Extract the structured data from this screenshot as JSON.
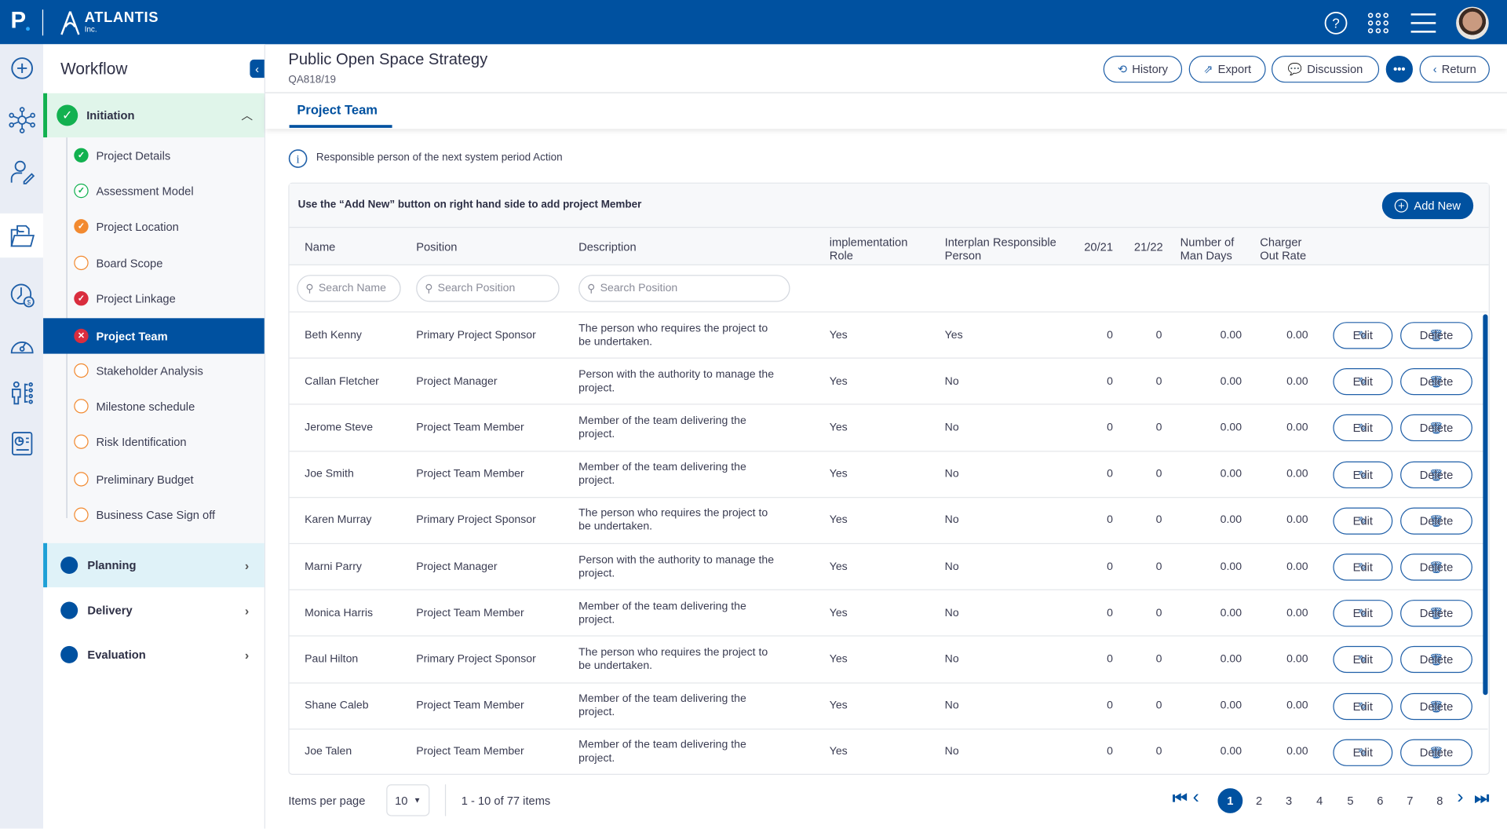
{
  "header": {
    "logo_letter": "P",
    "brand": "ATLANTIS",
    "brand_sub": "Inc.",
    "icons": [
      "help-icon",
      "apps-grid-icon",
      "menu-icon",
      "user-avatar"
    ]
  },
  "rail": {
    "icons": [
      "add-circle-icon",
      "network-icon",
      "user-edit-icon",
      "folder-icon",
      "time-money-icon",
      "speedometer-icon",
      "org-chart-icon",
      "report-icon"
    ]
  },
  "workflow": {
    "title": "Workflow",
    "initiation": {
      "label": "Initiation",
      "status": "complete"
    },
    "items": [
      {
        "label": "Project Details",
        "status": "complete",
        "color": "#12b150"
      },
      {
        "label": "Assessment Model",
        "status": "complete-outline",
        "color": "#12b150"
      },
      {
        "label": "Project Location",
        "status": "warning",
        "color": "#f28a30"
      },
      {
        "label": "Board Scope",
        "status": "pending",
        "color": "#f28a30"
      },
      {
        "label": "Project Linkage",
        "status": "error-complete",
        "color": "#d92d3e"
      },
      {
        "label": "Project Team",
        "status": "error",
        "color": "#d92d3e"
      },
      {
        "label": "Stakeholder Analysis",
        "status": "pending",
        "color": "#f28a30"
      },
      {
        "label": "Milestone schedule",
        "status": "pending",
        "color": "#f28a30"
      },
      {
        "label": "Risk Identification",
        "status": "pending",
        "color": "#f28a30"
      },
      {
        "label": "Preliminary Budget",
        "status": "pending",
        "color": "#f28a30"
      },
      {
        "label": "Business Case Sign off",
        "status": "pending",
        "color": "#f28a30"
      }
    ],
    "phases": [
      {
        "label": "Planning"
      },
      {
        "label": "Delivery"
      },
      {
        "label": "Evaluation"
      }
    ]
  },
  "page": {
    "title": "Public Open Space Strategy",
    "code": "QA818/19",
    "actions": {
      "history": "History",
      "export": "Export",
      "discussion": "Discussion",
      "return": "Return"
    },
    "tab": "Project Team",
    "info": "Responsible person of the next system period Action"
  },
  "table": {
    "instruction": "Use the “Add New” button on right hand side to add project Member",
    "add_new": "Add New",
    "columns": [
      "Name",
      "Position",
      "Description",
      "implementation Role",
      "Interplan Responsible Person",
      "20/21",
      "21/22",
      "Number of Man Days",
      "Charger Out Rate"
    ],
    "search": {
      "name": "Search Name",
      "position": "Search Position",
      "description": "Search Position"
    },
    "edit_label": "Edit",
    "delete_label": "Delete",
    "rows": [
      {
        "name": "Beth Kenny",
        "position": "Primary Project Sponsor",
        "description": "The person who requires the project to be undertaken.",
        "impl": "Yes",
        "interplan": "Yes",
        "y2021": "0",
        "y2122": "0",
        "man_days": "0.00",
        "rate": "0.00"
      },
      {
        "name": "Callan Fletcher",
        "position": "Project Manager",
        "description": "Person with the authority to manage the project.",
        "impl": "Yes",
        "interplan": "No",
        "y2021": "0",
        "y2122": "0",
        "man_days": "0.00",
        "rate": "0.00"
      },
      {
        "name": "Jerome Steve",
        "position": "Project Team Member",
        "description": "Member of the team delivering the project.",
        "impl": "Yes",
        "interplan": "No",
        "y2021": "0",
        "y2122": "0",
        "man_days": "0.00",
        "rate": "0.00"
      },
      {
        "name": "Joe Smith",
        "position": "Project Team Member",
        "description": "Member of the team delivering the project.",
        "impl": "Yes",
        "interplan": "No",
        "y2021": "0",
        "y2122": "0",
        "man_days": "0.00",
        "rate": "0.00"
      },
      {
        "name": "Karen Murray",
        "position": "Primary Project Sponsor",
        "description": "The person who requires the project to be undertaken.",
        "impl": "Yes",
        "interplan": "No",
        "y2021": "0",
        "y2122": "0",
        "man_days": "0.00",
        "rate": "0.00"
      },
      {
        "name": "Marni Parry",
        "position": "Project Manager",
        "description": "Person with the authority to manage the project.",
        "impl": "Yes",
        "interplan": "No",
        "y2021": "0",
        "y2122": "0",
        "man_days": "0.00",
        "rate": "0.00"
      },
      {
        "name": "Monica Harris",
        "position": "Project Team Member",
        "description": "Member of the team delivering the project.",
        "impl": "Yes",
        "interplan": "No",
        "y2021": "0",
        "y2122": "0",
        "man_days": "0.00",
        "rate": "0.00"
      },
      {
        "name": "Paul Hilton",
        "position": "Primary Project Sponsor",
        "description": "The person who requires the project to be undertaken.",
        "impl": "Yes",
        "interplan": "No",
        "y2021": "0",
        "y2122": "0",
        "man_days": "0.00",
        "rate": "0.00"
      },
      {
        "name": "Shane Caleb",
        "position": "Project Team Member",
        "description": "Member of the team delivering the project.",
        "impl": "Yes",
        "interplan": "No",
        "y2021": "0",
        "y2122": "0",
        "man_days": "0.00",
        "rate": "0.00"
      },
      {
        "name": "Joe Talen",
        "position": "Project Team Member",
        "description": "Member of the team delivering the project.",
        "impl": "Yes",
        "interplan": "No",
        "y2021": "0",
        "y2122": "0",
        "man_days": "0.00",
        "rate": "0.00"
      }
    ]
  },
  "pagination": {
    "items_per_page_label": "Items per page",
    "items_per_page": "10",
    "range": "1 - 10 of 77 items",
    "pages": [
      "1",
      "2",
      "3",
      "4",
      "5",
      "6",
      "7",
      "8"
    ],
    "current": "1"
  },
  "colors": {
    "primary": "#0051a0",
    "success": "#12b150",
    "warning": "#f28a30",
    "error": "#d92d3e"
  }
}
